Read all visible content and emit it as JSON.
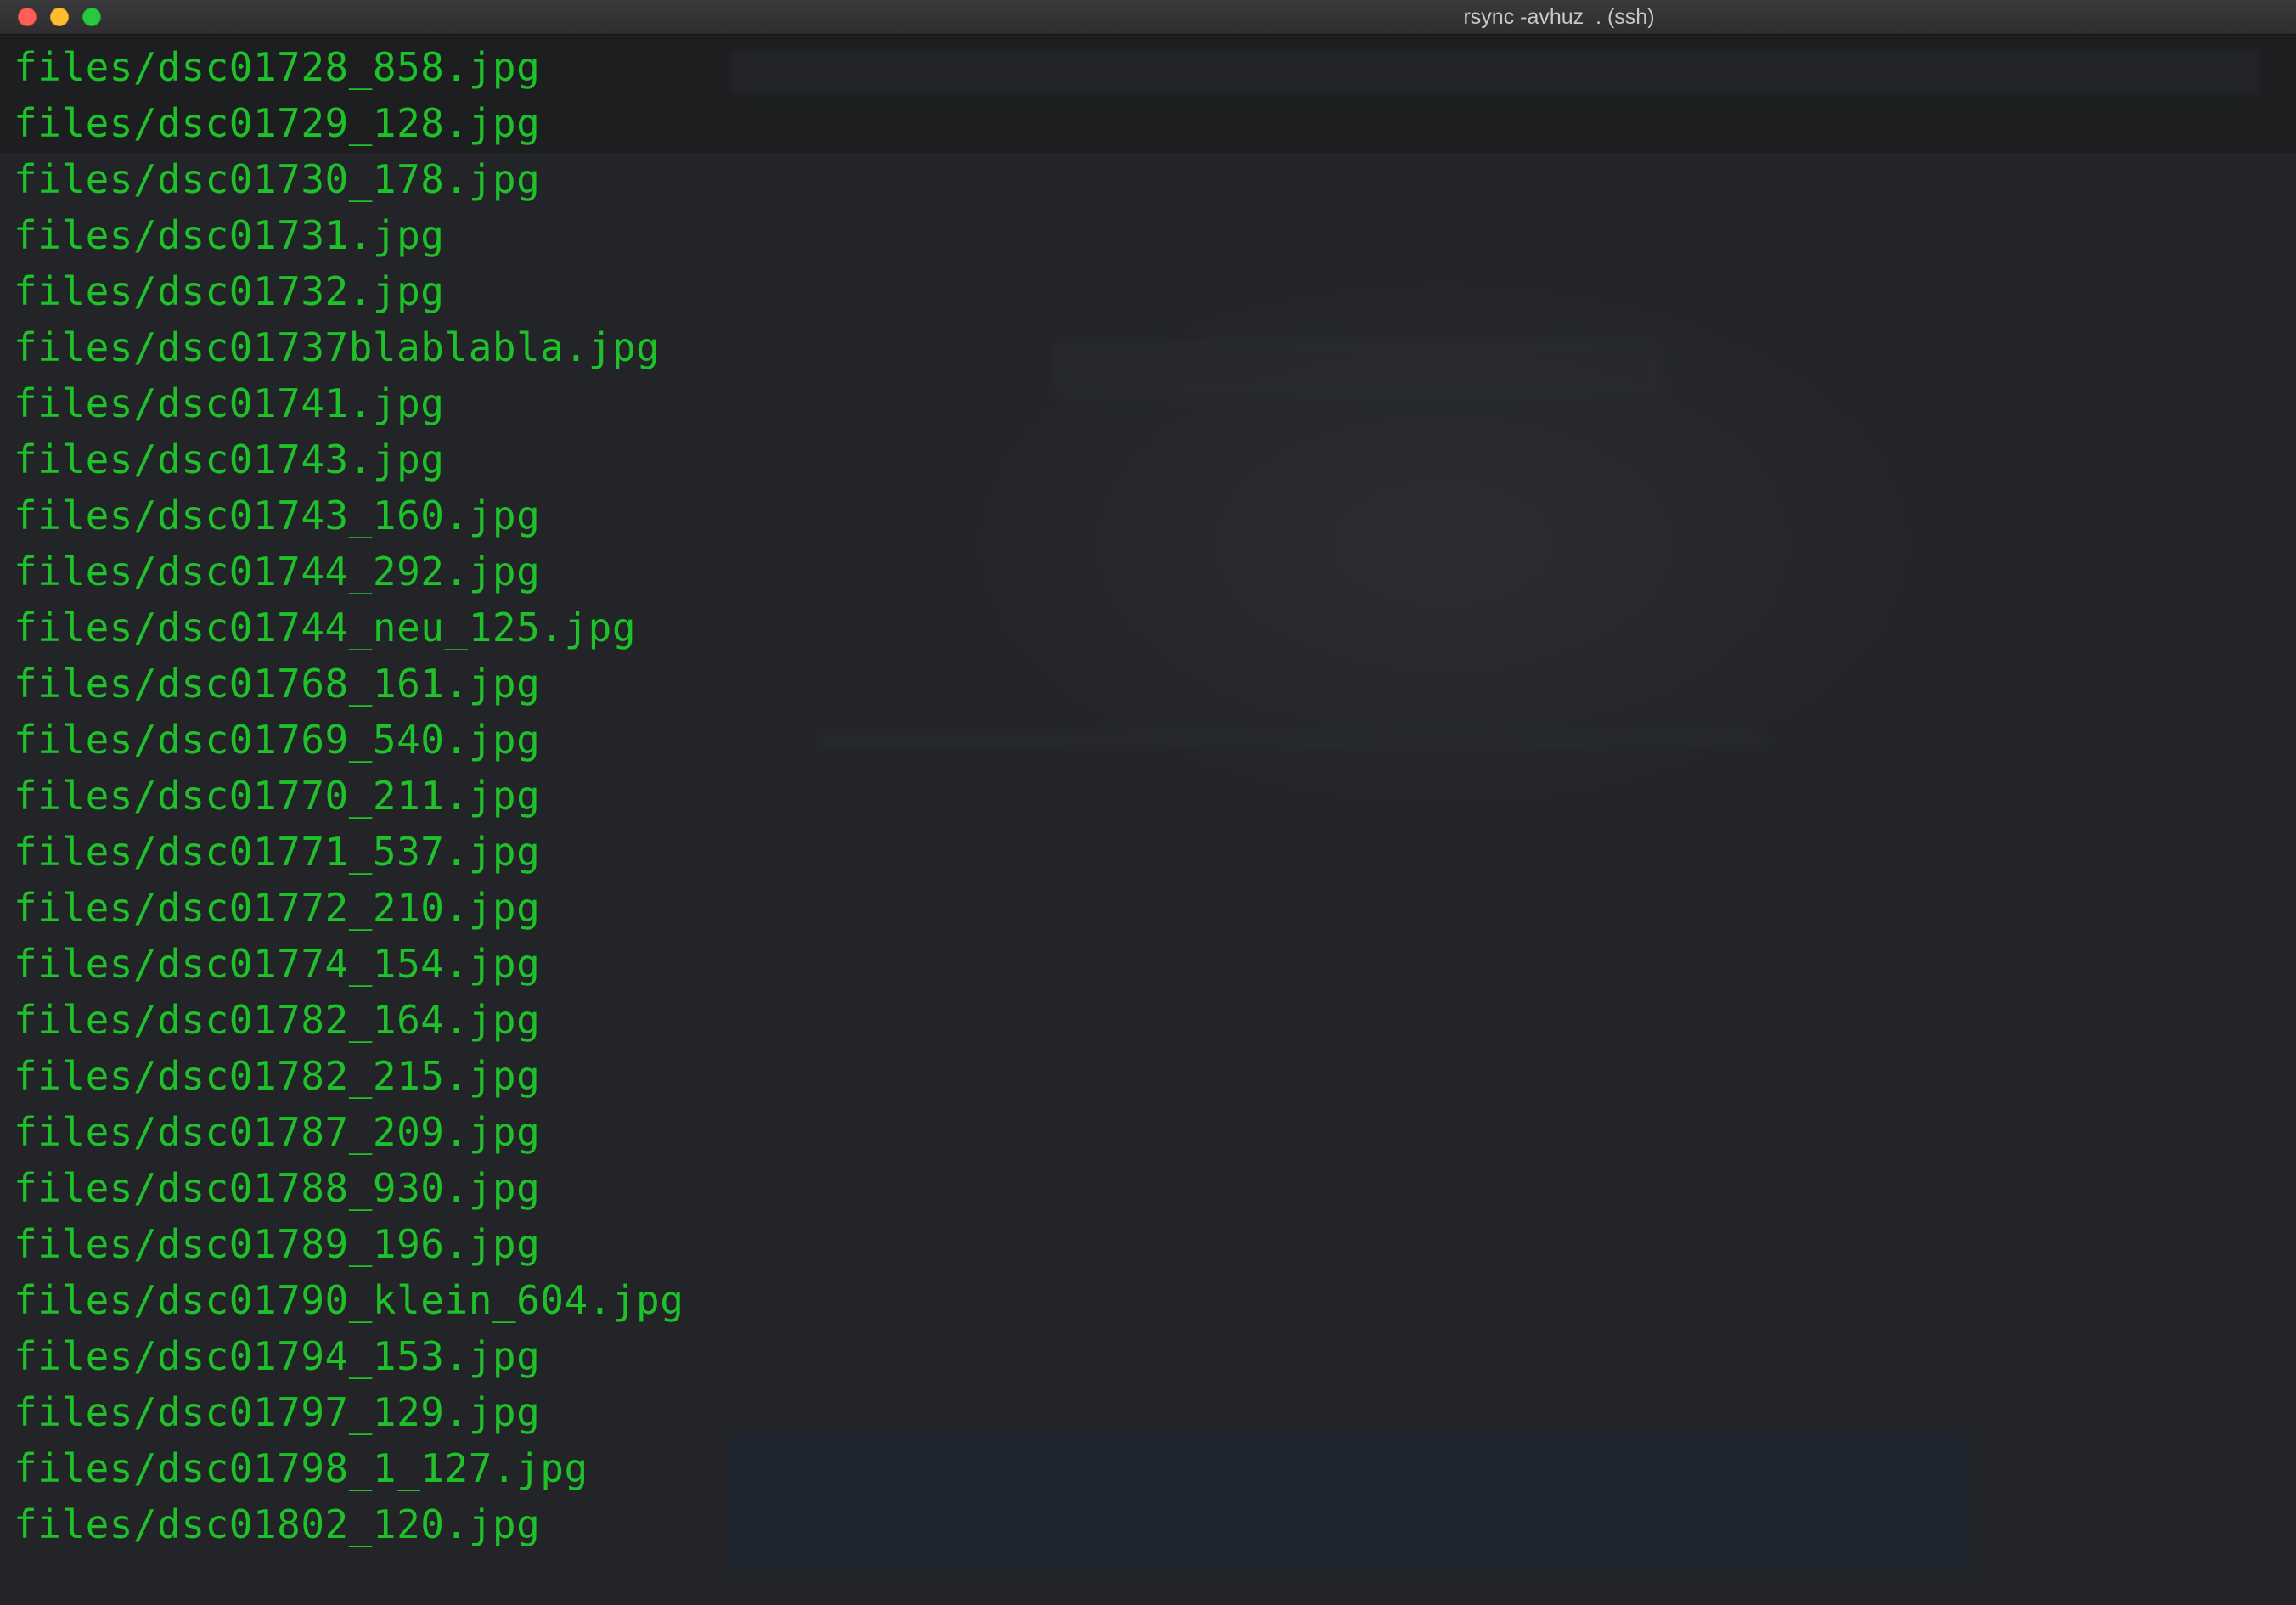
{
  "window": {
    "title": "rsync -avhuz  . (ssh)",
    "text_color": "#1fc12b",
    "background_color": "#1f2124"
  },
  "terminal": {
    "lines": [
      "files/dsc01728_858.jpg",
      "files/dsc01729_128.jpg",
      "files/dsc01730_178.jpg",
      "files/dsc01731.jpg",
      "files/dsc01732.jpg",
      "files/dsc01737blablabla.jpg",
      "files/dsc01741.jpg",
      "files/dsc01743.jpg",
      "files/dsc01743_160.jpg",
      "files/dsc01744_292.jpg",
      "files/dsc01744_neu_125.jpg",
      "files/dsc01768_161.jpg",
      "files/dsc01769_540.jpg",
      "files/dsc01770_211.jpg",
      "files/dsc01771_537.jpg",
      "files/dsc01772_210.jpg",
      "files/dsc01774_154.jpg",
      "files/dsc01782_164.jpg",
      "files/dsc01782_215.jpg",
      "files/dsc01787_209.jpg",
      "files/dsc01788_930.jpg",
      "files/dsc01789_196.jpg",
      "files/dsc01790_klein_604.jpg",
      "files/dsc01794_153.jpg",
      "files/dsc01797_129.jpg",
      "files/dsc01798_1_127.jpg",
      "files/dsc01802_120.jpg"
    ]
  }
}
